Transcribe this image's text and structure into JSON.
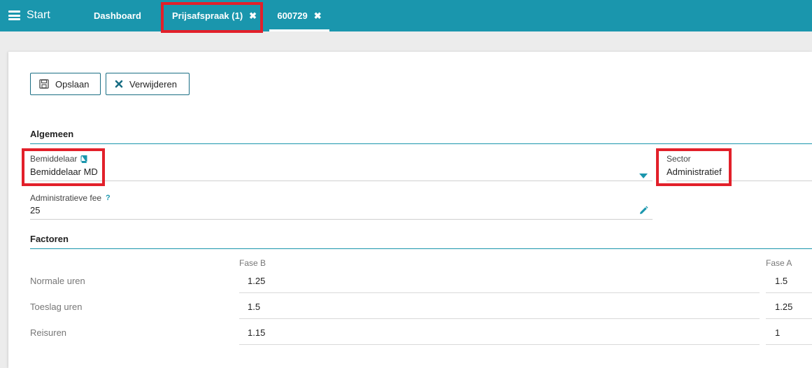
{
  "header": {
    "start_label": "Start",
    "tabs": [
      {
        "label": "Dashboard"
      },
      {
        "label": "Prijsafspraak (1)",
        "close": "✖"
      },
      {
        "label": "600729",
        "close": "✖"
      }
    ]
  },
  "toolbar": {
    "save_label": "Opslaan",
    "delete_label": "Verwijderen"
  },
  "algemeen": {
    "title": "Algemeen",
    "bemiddelaar": {
      "label": "Bemiddelaar",
      "value": "Bemiddelaar MD"
    },
    "sector": {
      "label": "Sector",
      "value": "Administratief"
    },
    "fee": {
      "label": "Administratieve fee",
      "help": "?",
      "value": "25"
    }
  },
  "factoren": {
    "title": "Factoren",
    "columns": [
      "Fase B",
      "Fase A"
    ],
    "rows": [
      {
        "label": "Normale uren",
        "values": [
          "1.25",
          "1.5"
        ]
      },
      {
        "label": "Toeslag uren",
        "values": [
          "1.5",
          "1.25"
        ]
      },
      {
        "label": "Reisuren",
        "values": [
          "1.15",
          "1"
        ]
      }
    ]
  },
  "colors": {
    "accent": "#1a96ad",
    "highlight": "#e2202a"
  }
}
